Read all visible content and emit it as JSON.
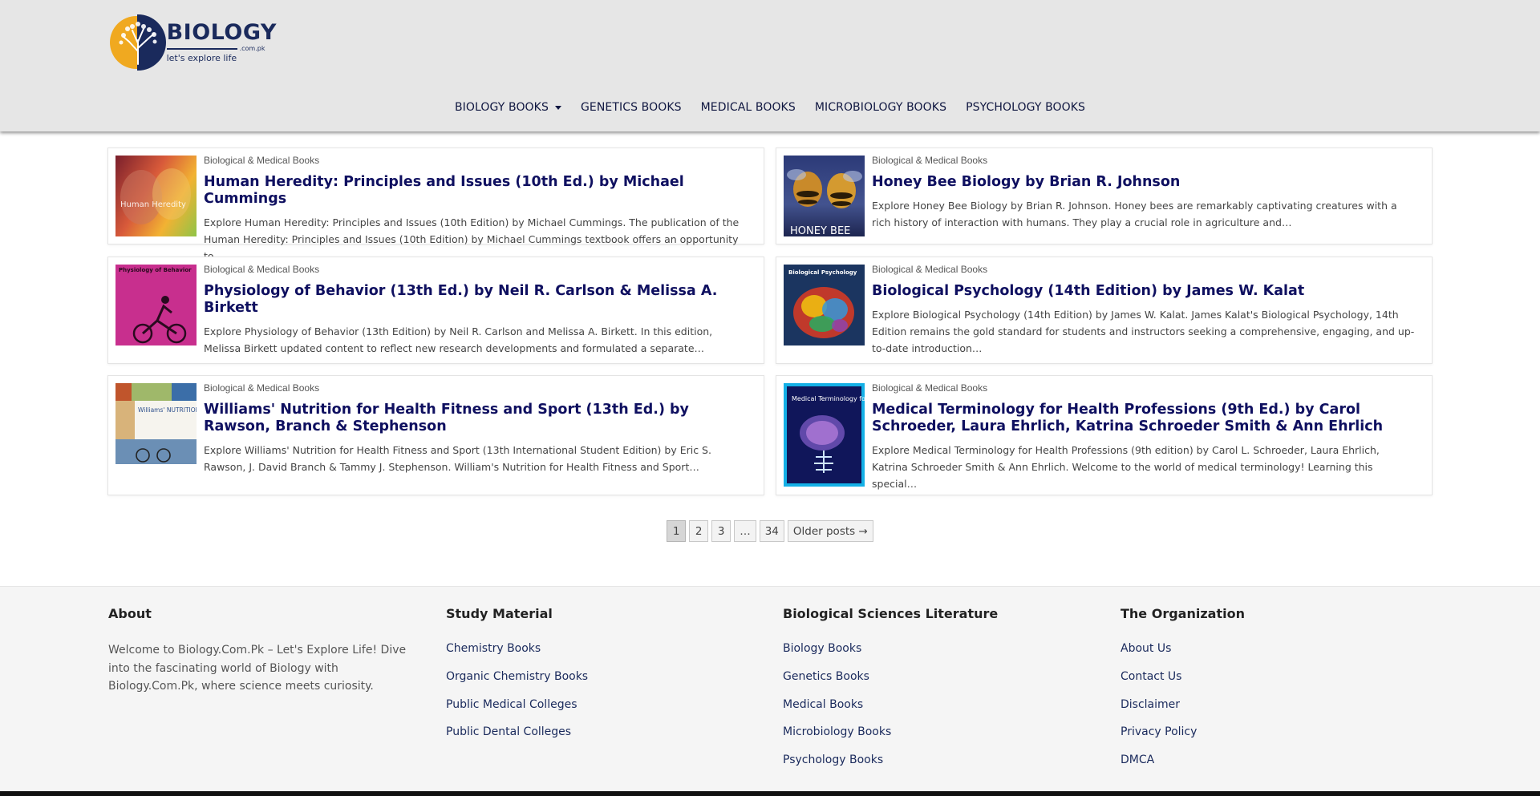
{
  "site": {
    "logo_title": "BIOLOGY",
    "logo_domain": ".com.pk",
    "logo_tagline": "let's explore life"
  },
  "nav": {
    "items": [
      {
        "label": "BIOLOGY BOOKS"
      },
      {
        "label": "GENETICS BOOKS"
      },
      {
        "label": "MEDICAL BOOKS"
      },
      {
        "label": "MICROBIOLOGY BOOKS"
      },
      {
        "label": "PSYCHOLOGY BOOKS"
      }
    ]
  },
  "posts": [
    {
      "category": "Biological & Medical Books",
      "title": "Human Heredity: Principles and Issues (10th Ed.) by Michael Cummings",
      "excerpt": "Explore Human Heredity: Principles and Issues (10th Edition) by Michael Cummings. The publication of the Human Heredity: Principles and Issues (10th Edition) by Michael Cummings textbook offers an opportunity to…",
      "cover_text": "Human Heredity"
    },
    {
      "category": "Biological & Medical Books",
      "title": "Honey Bee Biology by Brian R. Johnson",
      "excerpt": "Explore Honey Bee Biology by Brian R. Johnson. Honey bees are remarkably captivating creatures with a rich history of interaction with humans. They play a crucial role in agriculture and…",
      "cover_text": "HONEY BEE"
    },
    {
      "category": "Biological & Medical Books",
      "title": "Physiology of Behavior (13th Ed.) by Neil R. Carlson & Melissa A. Birkett",
      "excerpt": "Explore Physiology of Behavior (13th Edition) by Neil R. Carlson and Melissa A. Birkett. In this edition, Melissa Birkett updated content to reflect new research developments and formulated a separate…",
      "cover_text": "Physiology of Behavior"
    },
    {
      "category": "Biological & Medical Books",
      "title": "Biological Psychology (14th Edition) by James W. Kalat",
      "excerpt": "Explore Biological Psychology (14th Edition) by James W. Kalat. James Kalat's Biological Psychology, 14th Edition remains the gold standard for students and instructors seeking a comprehensive, engaging, and up-to-date introduction…",
      "cover_text": "Biological Psychology"
    },
    {
      "category": "Biological & Medical Books",
      "title": "Williams' Nutrition for Health Fitness and Sport (13th Ed.) by Rawson, Branch & Stephenson",
      "excerpt": "Explore Williams' Nutrition for Health Fitness and Sport (13th International Student Edition) by Eric S. Rawson, J. David Branch & Tammy J. Stephenson. William's Nutrition for Health Fitness and Sport…",
      "cover_text": "Williams' NUTRITION"
    },
    {
      "category": "Biological & Medical Books",
      "title": "Medical Terminology for Health Professions (9th Ed.) by Carol Schroeder, Laura Ehrlich, Katrina Schroeder Smith & Ann Ehrlich",
      "excerpt": "Explore Medical Terminology for Health Professions (9th edition) by Carol L. Schroeder, Laura Ehrlich, Katrina Schroeder Smith & Ann Ehrlich. Welcome to the world of medical terminology! Learning this special…",
      "cover_text": "Medical Terminology for Health Professions"
    }
  ],
  "pagination": {
    "pages": [
      "1",
      "2",
      "3",
      "…",
      "34"
    ],
    "older": "Older posts →"
  },
  "footer": {
    "about": {
      "heading": "About",
      "text": "Welcome to Biology.Com.Pk  – Let's Explore Life! Dive into the fascinating world of Biology with Biology.Com.Pk, where science meets curiosity."
    },
    "study": {
      "heading": "Study Material",
      "links": [
        "Chemistry Books",
        "Organic Chemistry Books",
        "Public Medical Colleges",
        "Public Dental Colleges"
      ]
    },
    "literature": {
      "heading": "Biological Sciences Literature",
      "links": [
        "Biology Books",
        "Genetics Books",
        "Medical Books",
        "Microbiology Books",
        "Psychology Books"
      ]
    },
    "org": {
      "heading": "The Organization",
      "links": [
        "About Us",
        "Contact Us",
        "Disclaimer",
        "Privacy Policy",
        "DMCA"
      ]
    }
  }
}
